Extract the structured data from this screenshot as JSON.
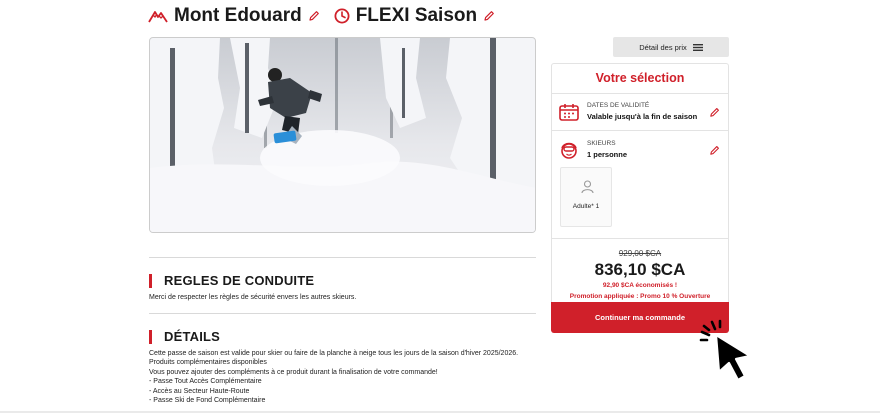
{
  "header": {
    "mountain_title": "Mont Edouard",
    "pass_title": "FLEXI Saison"
  },
  "colors": {
    "accent": "#d0202a",
    "text": "#1a1a1a"
  },
  "sections": {
    "conduct_title": "REGLES DE CONDUITE",
    "conduct_text": "Merci de respecter les règles de sécurité envers les autres skieurs.",
    "details_title": "DÉTAILS",
    "details_lines": [
      "Cette passe de saison est valide pour skier ou faire de la planche à neige tous les jours de la saison d'hiver 2025/2026.",
      "Produits complémentaires disponibles",
      "Vous pouvez ajouter des compléments à ce produit durant la finalisation de votre commande!",
      "- Passe Tout Accès Complémentaire",
      "- Accès au Secteur Haute-Route",
      "- Passe Ski de Fond Complémentaire"
    ]
  },
  "price_details_button": "Détail des prix",
  "selection": {
    "title": "Votre sélection",
    "validity_label": "DATES DE VALIDITÉ",
    "validity_value": "Valable jusqu'à la fin de saison",
    "skiers_label": "SKIEURS",
    "skiers_value": "1 personne",
    "skier_card_label": "Adulte* 1",
    "old_price": "929,00 $CA",
    "new_price": "836,10 $CA",
    "saved": "92,90 $CA économisés !",
    "promo": "Promotion appliquée : Promo 10 % Ouverture",
    "cta": "Continuer ma commande"
  },
  "icons": {
    "mountain": "mountain-icon",
    "clock": "clock-icon",
    "edit": "pencil-icon",
    "calendar": "calendar-icon",
    "skier": "skier-face-icon",
    "person": "person-icon",
    "menu": "menu-icon",
    "cursor": "hand-pointer-cursor-icon"
  }
}
